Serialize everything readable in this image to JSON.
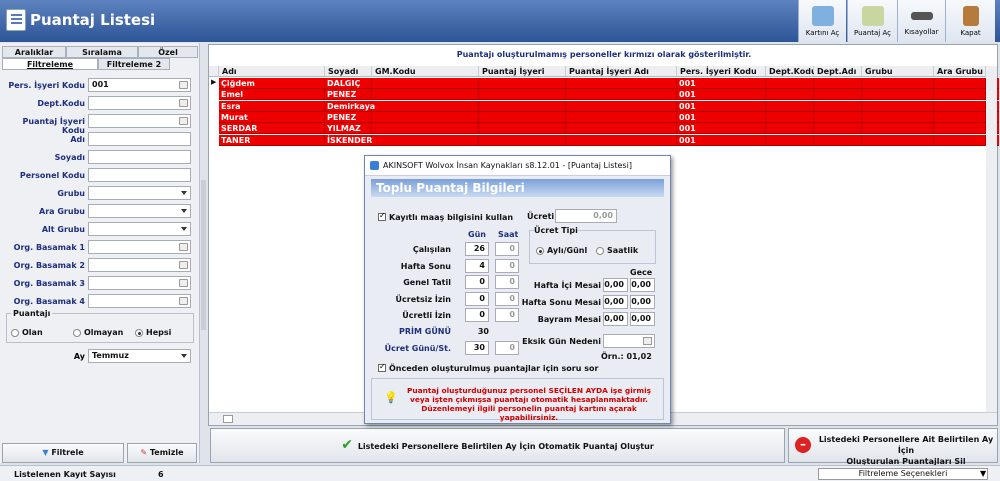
{
  "window": {
    "title": "Puantaj Listesi"
  },
  "toolbar": {
    "buttons": [
      {
        "label": "Kartını Aç"
      },
      {
        "label": "Puantaj Aç"
      },
      {
        "label": "Kısayollar"
      },
      {
        "label": "Kapat"
      }
    ]
  },
  "left": {
    "tabs_top": [
      "Aralıklar",
      "Sıralama",
      "Özel"
    ],
    "tabs_bottom": [
      "Filtreleme",
      "Filtreleme 2"
    ],
    "fields": [
      {
        "label": "Pers. İşyeri Kodu",
        "value": "001",
        "kind": "btn"
      },
      {
        "label": "Dept.Kodu",
        "value": "",
        "kind": "btn"
      },
      {
        "label": "Puantaj İşyeri Kodu",
        "value": "",
        "kind": "btn"
      },
      {
        "label": "Adı",
        "value": "",
        "kind": "text"
      },
      {
        "label": "Soyadı",
        "value": "",
        "kind": "text"
      },
      {
        "label": "Personel Kodu",
        "value": "",
        "kind": "text"
      },
      {
        "label": "Grubu",
        "value": "",
        "kind": "dd"
      },
      {
        "label": "Ara Grubu",
        "value": "",
        "kind": "dd"
      },
      {
        "label": "Alt Grubu",
        "value": "",
        "kind": "dd"
      },
      {
        "label": "Org. Basamak 1",
        "value": "",
        "kind": "btn"
      },
      {
        "label": "Org. Basamak 2",
        "value": "",
        "kind": "btn"
      },
      {
        "label": "Org. Basamak 3",
        "value": "",
        "kind": "btn"
      },
      {
        "label": "Org. Basamak 4",
        "value": "",
        "kind": "btn"
      }
    ],
    "puantaj": {
      "label": "Puantajı",
      "options": [
        "Olan",
        "Olmayan",
        "Hepsi"
      ],
      "selected": "Hepsi"
    },
    "ay": {
      "label": "Ay",
      "value": "Temmuz"
    },
    "filter_btn": "Filtrele",
    "clear_btn": "Temizle"
  },
  "grid": {
    "note": "Puantajı oluşturulmamış personeller kırmızı olarak gösterilmiştir.",
    "columns": [
      "Adı",
      "Soyadı",
      "GM.Kodu",
      "Puantaj İşyeri Kodu",
      "Puantaj İşyeri Adı",
      "Pers. İşyeri Kodu",
      "Dept.Kodu",
      "Dept.Adı",
      "Grubu",
      "Ara Grubu"
    ],
    "rows": [
      [
        "Çiğdem",
        "DALGIÇ",
        "",
        "",
        "",
        "001",
        "",
        "",
        "",
        ""
      ],
      [
        "Emel",
        "PENEZ",
        "",
        "",
        "",
        "001",
        "",
        "",
        "",
        ""
      ],
      [
        "Esra",
        "Demirkaya",
        "",
        "",
        "",
        "001",
        "",
        "",
        "",
        ""
      ],
      [
        "Murat",
        "PENEZ",
        "",
        "",
        "",
        "001",
        "",
        "",
        "",
        ""
      ],
      [
        "SERDAR",
        "YILMAZ",
        "",
        "",
        "",
        "001",
        "",
        "",
        "",
        ""
      ],
      [
        "TANER",
        "İSKENDER",
        "",
        "",
        "",
        "001",
        "",
        "",
        "",
        ""
      ]
    ]
  },
  "actions": {
    "create": "Listedeki Personellere Belirtilen Ay İçin Otomatik Puantaj Oluştur",
    "delete_line1": "Listedeki Personellere Ait Belirtilen Ay İçin",
    "delete_line2": "Oluşturulan Puantajları Sil"
  },
  "status": {
    "count_label": "Listelenen Kayıt Sayısı",
    "count": "6",
    "filter_options": "Filtreleme Seçenekleri"
  },
  "dialog": {
    "title": "AKINSOFT Wolvox İnsan Kaynakları s8.12.01 - [Puantaj Listesi]",
    "header": "Toplu Puantaj Bilgileri",
    "use_salary": "Kayıtlı maaş bilgisini kullan",
    "ucret_label": "Ücreti",
    "ucret_value": "0,00",
    "col_gun": "Gün",
    "col_saat": "Saat",
    "rows": [
      {
        "label": "Çalışılan",
        "gun": "26",
        "saat": "0"
      },
      {
        "label": "Hafta Sonu",
        "gun": "4",
        "saat": "0"
      },
      {
        "label": "Genel Tatil",
        "gun": "0",
        "saat": "0"
      },
      {
        "label": "Ücretsiz İzin",
        "gun": "0",
        "saat": "0"
      },
      {
        "label": "Ücretli İzin",
        "gun": "0",
        "saat": "0"
      }
    ],
    "prim_label": "PRİM GÜNÜ",
    "prim_value": "30",
    "ucret_gun_label": "Ücret Günü/St.",
    "ucret_gun_value": "30",
    "ucret_gun_saat": "0",
    "ucret_tipi": "Ücret Tipi",
    "ucret_opts": [
      "Aylı/Günl",
      "Saatlik"
    ],
    "gece": "Gece",
    "mesai": [
      {
        "label": "Hafta İçi Mesai",
        "a": "0,00",
        "b": "0,00"
      },
      {
        "label": "Hafta Sonu Mesai",
        "a": "0,00",
        "b": "0,00"
      },
      {
        "label": "Bayram Mesai",
        "a": "0,00",
        "b": "0,00"
      }
    ],
    "eksik": "Eksik Gün Nedeni",
    "orn": "Örn.: 01,02",
    "ask": "Önceden oluşturulmuş puantajlar için soru sor",
    "warning": "Puantaj oluşturduğunuz personel SEÇİLEN AYDA işe girmiş veya işten çıkmışsa puantajı otomatik hesaplanmaktadır. Düzenlemeyi ilgili personelin puantaj kartını açarak yapabilirsiniz.",
    "colors": {
      "warning": "#d40000",
      "accent": "#1d2f7e"
    }
  }
}
